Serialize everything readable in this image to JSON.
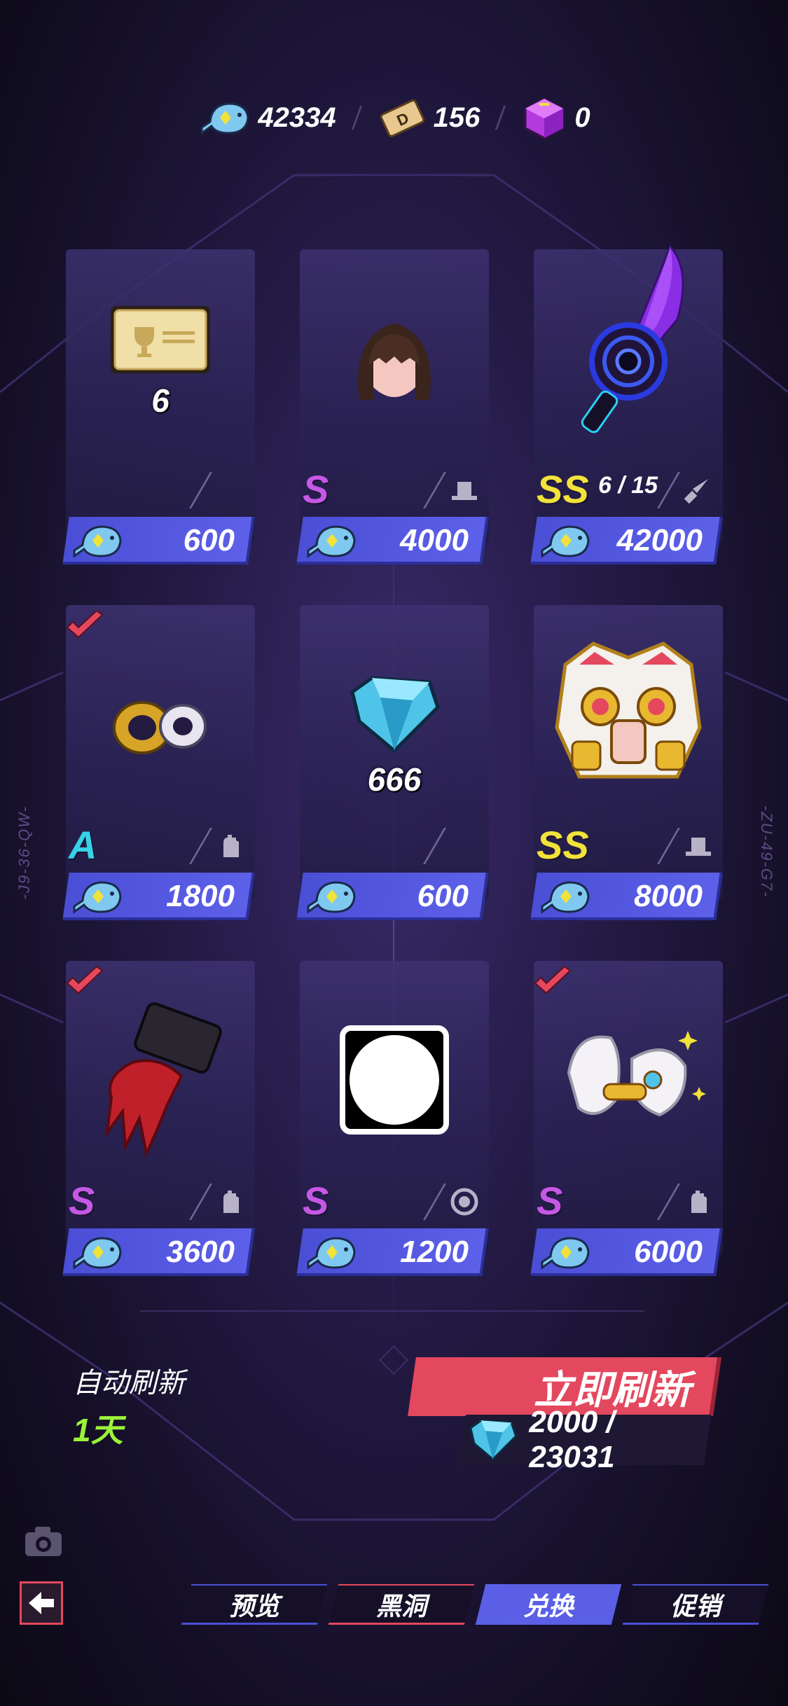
{
  "currencies": [
    {
      "icon": "fish-currency-icon",
      "value": "42334"
    },
    {
      "icon": "d-ticket-icon",
      "value": "156"
    },
    {
      "icon": "purple-cube-icon",
      "value": "0"
    }
  ],
  "side_codes": {
    "left": "-J9-36-QW-",
    "right": "-ZU-49-G7-"
  },
  "shop_items": [
    {
      "name": "event-ticket",
      "qty": "6",
      "rarity": "",
      "limit": "",
      "type_icon": "",
      "price": "600",
      "purchased": false
    },
    {
      "name": "hair-bob",
      "qty": "",
      "rarity": "S",
      "limit": "",
      "type_icon": "hat-icon",
      "price": "4000",
      "purchased": false
    },
    {
      "name": "nova-knife",
      "qty": "",
      "rarity": "SS",
      "limit": "6 / 15",
      "type_icon": "knife-icon",
      "price": "42000",
      "purchased": false
    },
    {
      "name": "rings",
      "qty": "",
      "rarity": "A",
      "limit": "",
      "type_icon": "glove-icon",
      "price": "1800",
      "purchased": true
    },
    {
      "name": "diamond",
      "qty": "666",
      "rarity": "",
      "limit": "",
      "type_icon": "",
      "price": "600",
      "purchased": false
    },
    {
      "name": "lion-mask",
      "qty": "",
      "rarity": "SS",
      "limit": "",
      "type_icon": "hat-icon",
      "price": "8000",
      "purchased": false
    },
    {
      "name": "red-claw-glove",
      "qty": "",
      "rarity": "S",
      "limit": "",
      "type_icon": "glove-icon",
      "price": "3600",
      "purchased": true
    },
    {
      "name": "white-circle-frame",
      "qty": "",
      "rarity": "S",
      "limit": "",
      "type_icon": "circle-target-icon",
      "price": "1200",
      "purchased": false
    },
    {
      "name": "white-gold-gloves",
      "qty": "",
      "rarity": "S",
      "limit": "",
      "type_icon": "glove-icon",
      "price": "6000",
      "purchased": true
    }
  ],
  "auto_refresh": {
    "label": "自动刷新",
    "days": "1天"
  },
  "refresh": {
    "label": "立即刷新",
    "cost": "2000 / 23031"
  },
  "tabs": [
    {
      "label": "预览",
      "active": false
    },
    {
      "label": "黑洞",
      "active": false
    },
    {
      "label": "兑换",
      "active": true
    },
    {
      "label": "促销",
      "active": false
    }
  ],
  "colors": {
    "accent_blue": "#5a5fe6",
    "accent_red": "#e4485e",
    "rarity_S": "#c658e6",
    "rarity_SS": "#f2e23a",
    "rarity_A": "#36d2e8",
    "days_green": "#9cf23a"
  }
}
